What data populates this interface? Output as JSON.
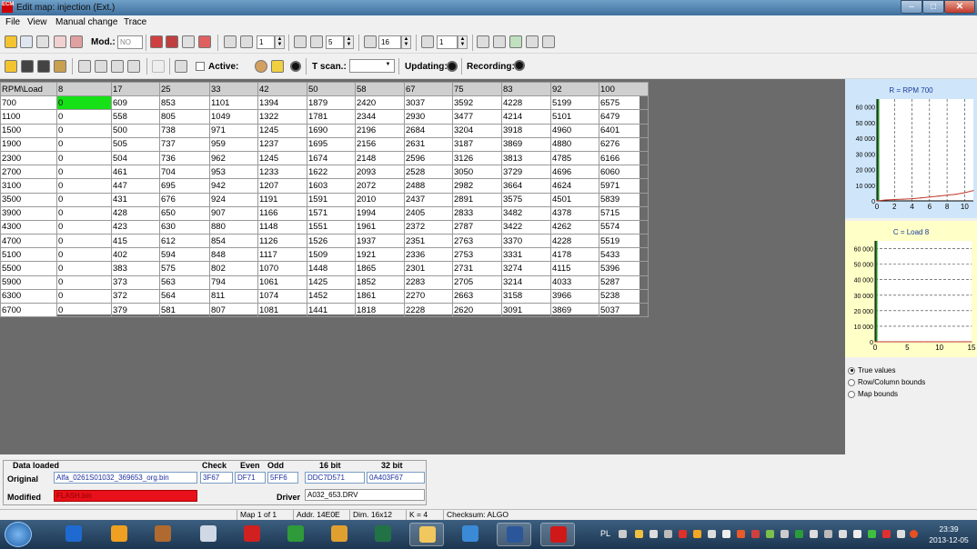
{
  "window": {
    "title": "Edit map: injection (Ext.)",
    "app_icon_text": "ECM"
  },
  "menu": [
    {
      "label": "File",
      "left": 6
    },
    {
      "label": "View",
      "left": 30
    },
    {
      "label": "Manual change",
      "left": 61
    },
    {
      "label": "Trace",
      "left": 136
    }
  ],
  "toolbar1": {
    "mod_label": "Mod.:",
    "mod_value": "NO",
    "spin1_value": "1",
    "spin2_value": "5",
    "spin3_value": "16",
    "spin4_value": "1"
  },
  "toolbar2": {
    "active_label": "Active:",
    "tscan_label": "T scan.:",
    "tscan_value": "",
    "updating_label": "Updating:",
    "recording_label": "Recording:"
  },
  "grid": {
    "corner_label": "RPM\\Load",
    "columns": [
      "8",
      "17",
      "25",
      "33",
      "42",
      "50",
      "58",
      "67",
      "75",
      "83",
      "92",
      "100"
    ],
    "rows": [
      {
        "rpm": "700",
        "values": [
          "0",
          "609",
          "853",
          "1101",
          "1394",
          "1879",
          "2420",
          "3037",
          "3592",
          "4228",
          "5199",
          "6575"
        ]
      },
      {
        "rpm": "1100",
        "values": [
          "0",
          "558",
          "805",
          "1049",
          "1322",
          "1781",
          "2344",
          "2930",
          "3477",
          "4214",
          "5101",
          "6479"
        ]
      },
      {
        "rpm": "1500",
        "values": [
          "0",
          "500",
          "738",
          "971",
          "1245",
          "1690",
          "2196",
          "2684",
          "3204",
          "3918",
          "4960",
          "6401"
        ]
      },
      {
        "rpm": "1900",
        "values": [
          "0",
          "505",
          "737",
          "959",
          "1237",
          "1695",
          "2156",
          "2631",
          "3187",
          "3869",
          "4880",
          "6276"
        ]
      },
      {
        "rpm": "2300",
        "values": [
          "0",
          "504",
          "736",
          "962",
          "1245",
          "1674",
          "2148",
          "2596",
          "3126",
          "3813",
          "4785",
          "6166"
        ]
      },
      {
        "rpm": "2700",
        "values": [
          "0",
          "461",
          "704",
          "953",
          "1233",
          "1622",
          "2093",
          "2528",
          "3050",
          "3729",
          "4696",
          "6060"
        ]
      },
      {
        "rpm": "3100",
        "values": [
          "0",
          "447",
          "695",
          "942",
          "1207",
          "1603",
          "2072",
          "2488",
          "2982",
          "3664",
          "4624",
          "5971"
        ]
      },
      {
        "rpm": "3500",
        "values": [
          "0",
          "431",
          "676",
          "924",
          "1191",
          "1591",
          "2010",
          "2437",
          "2891",
          "3575",
          "4501",
          "5839"
        ]
      },
      {
        "rpm": "3900",
        "values": [
          "0",
          "428",
          "650",
          "907",
          "1166",
          "1571",
          "1994",
          "2405",
          "2833",
          "3482",
          "4378",
          "5715"
        ]
      },
      {
        "rpm": "4300",
        "values": [
          "0",
          "423",
          "630",
          "880",
          "1148",
          "1551",
          "1961",
          "2372",
          "2787",
          "3422",
          "4262",
          "5574"
        ]
      },
      {
        "rpm": "4700",
        "values": [
          "0",
          "415",
          "612",
          "854",
          "1126",
          "1526",
          "1937",
          "2351",
          "2763",
          "3370",
          "4228",
          "5519"
        ]
      },
      {
        "rpm": "5100",
        "values": [
          "0",
          "402",
          "594",
          "848",
          "1117",
          "1509",
          "1921",
          "2336",
          "2753",
          "3331",
          "4178",
          "5433"
        ]
      },
      {
        "rpm": "5500",
        "values": [
          "0",
          "383",
          "575",
          "802",
          "1070",
          "1448",
          "1865",
          "2301",
          "2731",
          "3274",
          "4115",
          "5396"
        ]
      },
      {
        "rpm": "5900",
        "values": [
          "0",
          "373",
          "563",
          "794",
          "1061",
          "1425",
          "1852",
          "2283",
          "2705",
          "3214",
          "4033",
          "5287"
        ]
      },
      {
        "rpm": "6300",
        "values": [
          "0",
          "372",
          "564",
          "811",
          "1074",
          "1452",
          "1861",
          "2270",
          "2663",
          "3158",
          "3966",
          "5238"
        ]
      },
      {
        "rpm": "6700",
        "values": [
          "0",
          "379",
          "581",
          "807",
          "1081",
          "1441",
          "1818",
          "2228",
          "2620",
          "3091",
          "3869",
          "5037"
        ]
      }
    ],
    "selected_cell_color": "#16e016"
  },
  "chart_data": [
    {
      "type": "line",
      "title": "R = RPM 700",
      "x": [
        0,
        1,
        2,
        3,
        4,
        5,
        6,
        7,
        8,
        9,
        10,
        11
      ],
      "values": [
        0,
        609,
        853,
        1101,
        1394,
        1879,
        2420,
        3037,
        3592,
        4228,
        5199,
        6575
      ],
      "xlim": [
        0,
        11
      ],
      "ylim": [
        0,
        65000
      ],
      "xticks": [
        0,
        2,
        4,
        6,
        8,
        10
      ],
      "yticks": [
        0,
        10000,
        20000,
        30000,
        40000,
        50000,
        60000
      ],
      "ytick_labels": [
        "0",
        "10 000",
        "20 000",
        "30 000",
        "40 000",
        "50 000",
        "60 000"
      ],
      "grid": "vertical dashed",
      "line_color": "#c0392b",
      "background": "#cfe6fa"
    },
    {
      "type": "line",
      "title": "C = Load 8",
      "x": [
        0,
        1,
        2,
        3,
        4,
        5,
        6,
        7,
        8,
        9,
        10,
        11,
        12,
        13,
        14,
        15
      ],
      "values": [
        0,
        0,
        0,
        0,
        0,
        0,
        0,
        0,
        0,
        0,
        0,
        0,
        0,
        0,
        0,
        0
      ],
      "xlim": [
        0,
        15
      ],
      "ylim": [
        0,
        65000
      ],
      "xticks": [
        0,
        5,
        10,
        15
      ],
      "yticks": [
        0,
        10000,
        20000,
        30000,
        40000,
        50000,
        60000
      ],
      "ytick_labels": [
        "0",
        "10 000",
        "20 000",
        "30 000",
        "40 000",
        "50 000",
        "60 000"
      ],
      "grid": "horizontal dashed",
      "line_color": "#c0392b",
      "background": "#ffffc8"
    }
  ],
  "view_options": {
    "options": [
      "True values",
      "Row/Column bounds",
      "Map bounds"
    ],
    "selected": "True values"
  },
  "data_loaded": {
    "legend": "Data loaded",
    "original_label": "Original",
    "original_file": "Alfa_0261S01032_369653_org.bin",
    "modified_label": "Modified",
    "modified_file": "FLASH.bin",
    "modified_color": "#e8101a",
    "check_header": "Check",
    "even_header": "Even",
    "odd_header": "Odd",
    "bit16_header": "16 bit",
    "bit32_header": "32 bit",
    "check_value": "3F67",
    "even_value": "DF71",
    "odd_value": "5FF6",
    "bit16_value": "DDC7D571",
    "bit32_value": "0A403F67",
    "driver_label": "Driver",
    "driver_value": "A032_653.DRV"
  },
  "status": {
    "map": "Map 1 of 1",
    "addr": "Addr. 14E0E",
    "dim": "Dim. 16x12",
    "k": "K = 4",
    "checksum": "Checksum: ALGO"
  },
  "taskbar": {
    "lang": "PL",
    "time": "23:39",
    "date": "2013-12-05",
    "apps": [
      "media-player",
      "outlook",
      "folder-app",
      "calculator",
      "acrobat",
      "chrome",
      "paint",
      "excel",
      "explorer",
      "misc",
      "word",
      "ecm"
    ]
  }
}
